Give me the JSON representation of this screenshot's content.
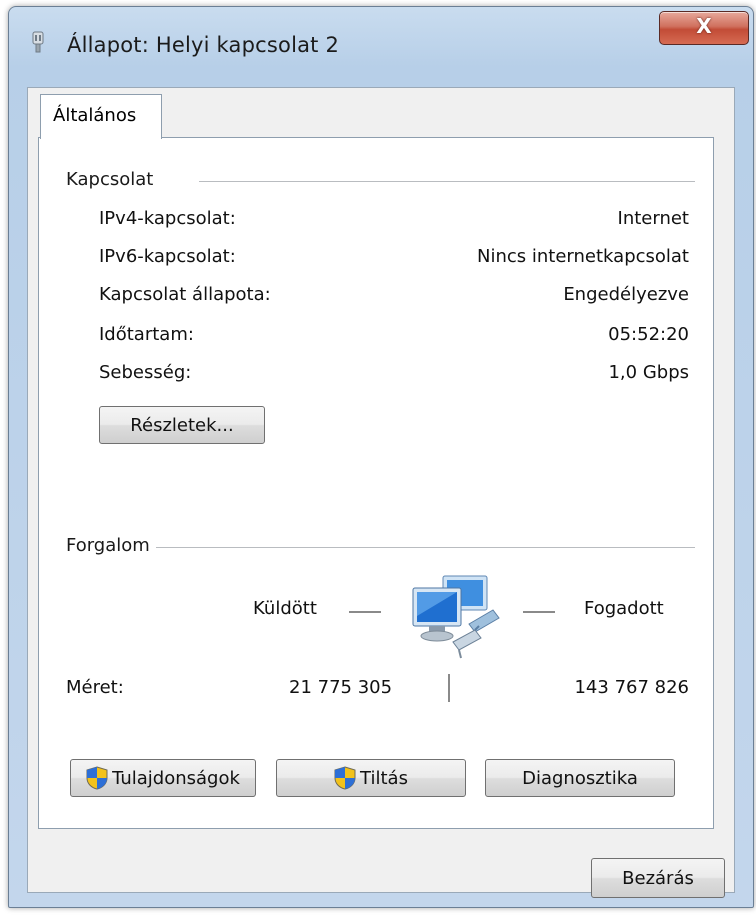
{
  "window": {
    "title": "Állapot: Helyi kapcsolat 2",
    "close_label": "X"
  },
  "tabs": [
    {
      "label": "Általános"
    }
  ],
  "connection": {
    "heading": "Kapcsolat",
    "rows": [
      {
        "label": "IPv4-kapcsolat:",
        "value": "Internet"
      },
      {
        "label": "IPv6-kapcsolat:",
        "value": "Nincs internetkapcsolat"
      },
      {
        "label": "Kapcsolat állapota:",
        "value": "Engedélyezve"
      },
      {
        "label": "Időtartam:",
        "value": "05:52:20"
      },
      {
        "label": "Sebesség:",
        "value": "1,0 Gbps"
      }
    ],
    "details_button": "Részletek..."
  },
  "traffic": {
    "heading": "Forgalom",
    "sent_label": "Küldött",
    "received_label": "Fogadott",
    "size_label": "Méret:",
    "sent_value": "21 775 305",
    "received_value": "143 767 826"
  },
  "actions": {
    "properties": "Tulajdonságok",
    "disable": "Tiltás",
    "diagnose": "Diagnosztika"
  },
  "footer": {
    "close": "Bezárás"
  },
  "icons": {
    "title": "network-adapter-icon",
    "shield": "uac-shield-icon",
    "network": "network-computers-icon"
  }
}
